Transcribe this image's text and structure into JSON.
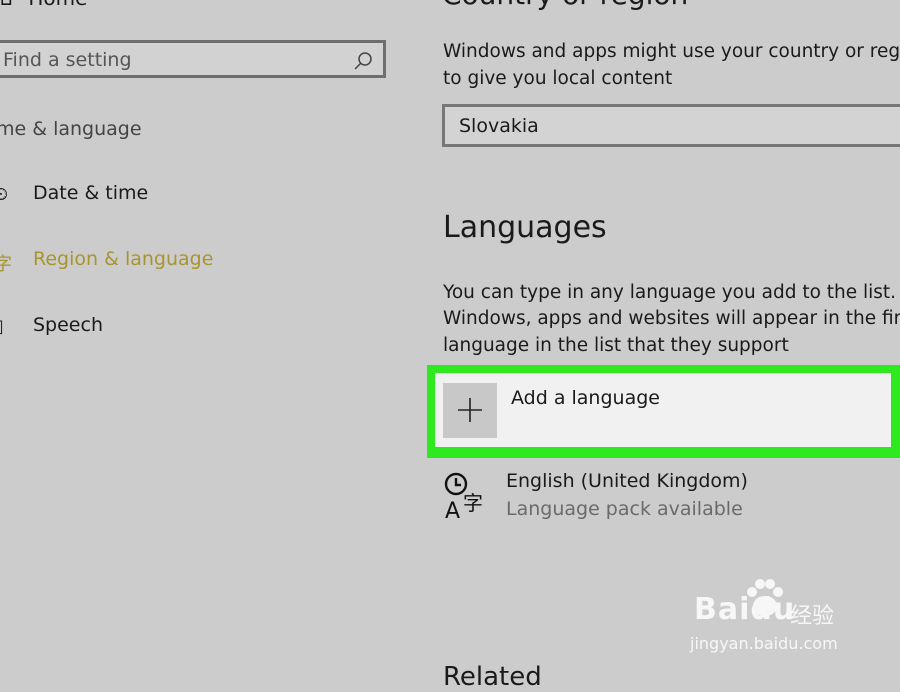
{
  "sidebar": {
    "home_label": "Home",
    "search_placeholder": "Find a setting",
    "section_title": "me & language",
    "items": [
      {
        "label": "Date & time",
        "icon": "clock-calendar-icon",
        "active": false
      },
      {
        "label": "Region & language",
        "icon": "language-character-icon",
        "active": true
      },
      {
        "label": "Speech",
        "icon": "microphone-icon",
        "active": false
      }
    ]
  },
  "main": {
    "country_heading": "Country or region",
    "country_desc_line1": "Windows and apps might use your country or regi",
    "country_desc_line2": "to give you local content",
    "country_value": "Slovakia",
    "languages_heading": "Languages",
    "languages_desc": [
      "You can type in any language you add to the list.",
      "Windows, apps and websites will appear in the firs",
      "language in the list that they support"
    ],
    "add_language_label": "Add a language",
    "languages": [
      {
        "name": "English (United Kingdom)",
        "status": "Language pack available"
      }
    ],
    "bottom_heading": "Related"
  },
  "watermark": {
    "brand": "Baidu",
    "cn": "经验",
    "url": "jingyan.baidu.com"
  },
  "colors": {
    "background": "#cccccc",
    "accent": "#a8952f",
    "highlight": "#2ee820"
  }
}
